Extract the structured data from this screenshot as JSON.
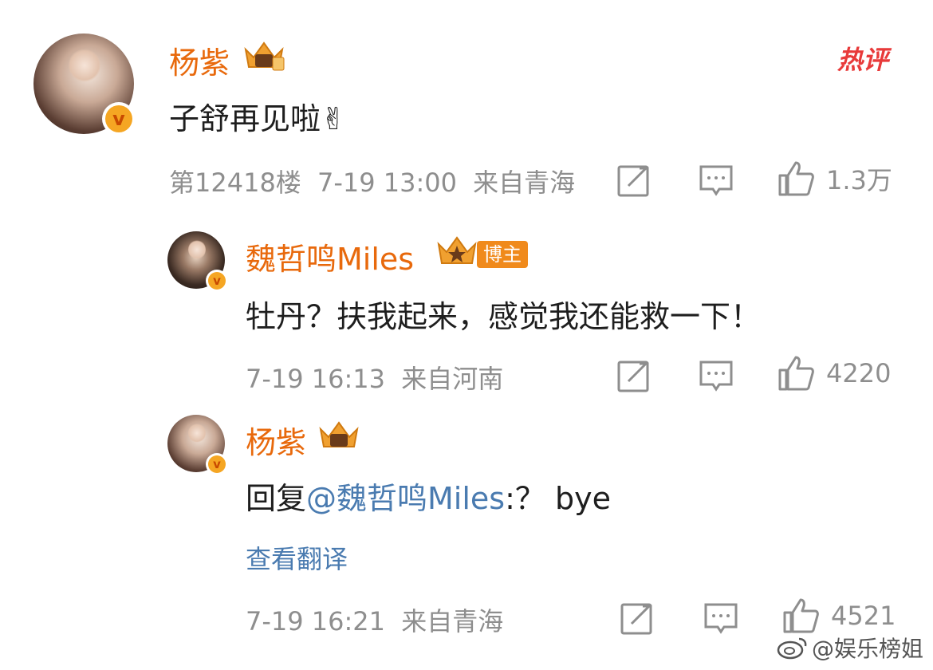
{
  "hot_badge": "热评",
  "comments": [
    {
      "username": "杨紫",
      "content": "子舒再见啦✌",
      "floor": "第12418楼",
      "time": "7-19 13:00",
      "location": "来自青海",
      "likes": "1.3万"
    },
    {
      "username": "魏哲鸣Miles",
      "author_tag": "博主",
      "content": "牡丹？扶我起来，感觉我还能救一下！",
      "time": "7-19 16:13",
      "location": "来自河南",
      "likes": "4220"
    },
    {
      "username": "杨紫",
      "reply_prefix": "回复",
      "mention": "@魏哲鸣Miles",
      "reply_text": ":？  bye",
      "translate": "查看翻译",
      "time": "7-19 16:21",
      "location": "来自青海",
      "likes": "4521"
    }
  ],
  "verified_mark": "v",
  "watermark": "@娱乐榜姐",
  "colors": {
    "username": "#e8690c",
    "mention": "#4a7bb0",
    "meta": "#8e8e8e",
    "hot": "#e83a3a"
  }
}
